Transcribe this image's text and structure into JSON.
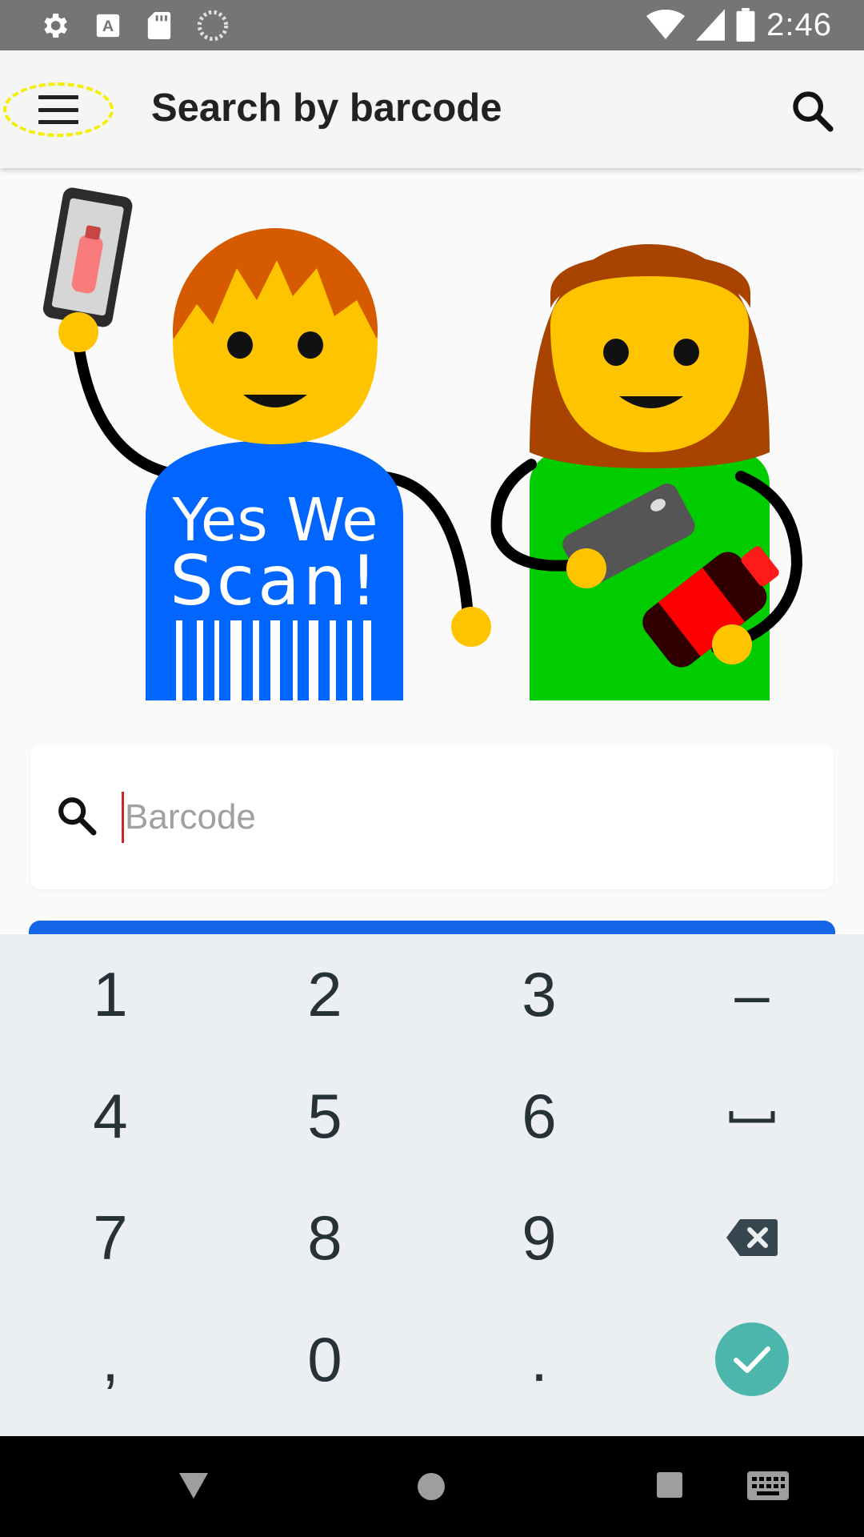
{
  "status_bar": {
    "time": "2:46",
    "icons": [
      "settings-icon",
      "text-a-icon",
      "sd-card-icon",
      "sync-icon",
      "wifi-icon",
      "signal-icon",
      "battery-icon"
    ]
  },
  "app_bar": {
    "title": "Search by barcode",
    "menu_icon": "hamburger-menu-icon",
    "search_icon": "search-icon"
  },
  "hero": {
    "shirt_text_line1": "Yes We",
    "shirt_text_line2": "Scan!"
  },
  "search": {
    "placeholder": "Barcode",
    "value": ""
  },
  "keyboard": {
    "rows": [
      [
        "1",
        "2",
        "3",
        "–"
      ],
      [
        "4",
        "5",
        "6",
        "space"
      ],
      [
        "7",
        "8",
        "9",
        "backspace"
      ],
      [
        ",",
        "0",
        ".",
        "enter"
      ]
    ],
    "labels": {
      "k1": "1",
      "k2": "2",
      "k3": "3",
      "kdash": "–",
      "k4": "4",
      "k5": "5",
      "k6": "6",
      "k7": "7",
      "k8": "8",
      "k9": "9",
      "kcomma": ",",
      "k0": "0",
      "kdot": "."
    }
  },
  "nav_bar": {
    "icons": [
      "back-icon",
      "home-icon",
      "recents-icon",
      "keyboard-icon"
    ]
  },
  "colors": {
    "status_bar": "#757575",
    "app_bar": "#f5f5f5",
    "accent_blue": "#1565e8",
    "enter_key": "#4db6ac",
    "keyboard_bg": "#eceff1"
  }
}
